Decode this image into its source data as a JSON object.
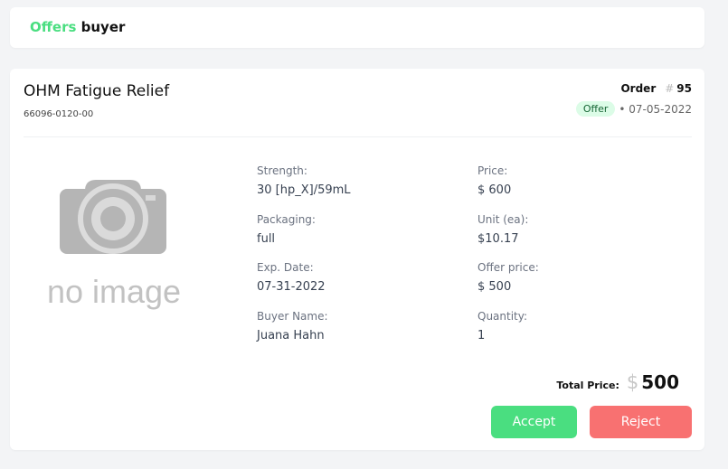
{
  "header": {
    "title_part1": "Offers",
    "title_part2": "buyer"
  },
  "product": {
    "name": "OHM Fatigue Relief",
    "code": "66096-0120-00",
    "image_placeholder": "no image"
  },
  "order": {
    "label": "Order",
    "hash": "#",
    "number": "95",
    "status_badge": "Offer",
    "date": "• 07-05-2022"
  },
  "details": {
    "strength_label": "Strength:",
    "strength_value": "30 [hp_X]/59mL",
    "packaging_label": "Packaging:",
    "packaging_value": "full",
    "exp_label": "Exp. Date:",
    "exp_value": "07-31-2022",
    "buyer_label": "Buyer Name:",
    "buyer_value": "Juana Hahn",
    "price_label": "Price:",
    "price_value": "$ 600",
    "unit_label": "Unit (ea):",
    "unit_value": "$10.17",
    "offer_label": "Offer price:",
    "offer_value": "$ 500",
    "qty_label": "Quantity:",
    "qty_value": "1"
  },
  "total": {
    "label": "Total Price:",
    "currency": "$",
    "amount": "500"
  },
  "actions": {
    "accept": "Accept",
    "reject": "Reject"
  },
  "colors": {
    "accent_green": "#4ade80",
    "reject_red": "#f87171",
    "badge_bg": "#dcfce7"
  }
}
